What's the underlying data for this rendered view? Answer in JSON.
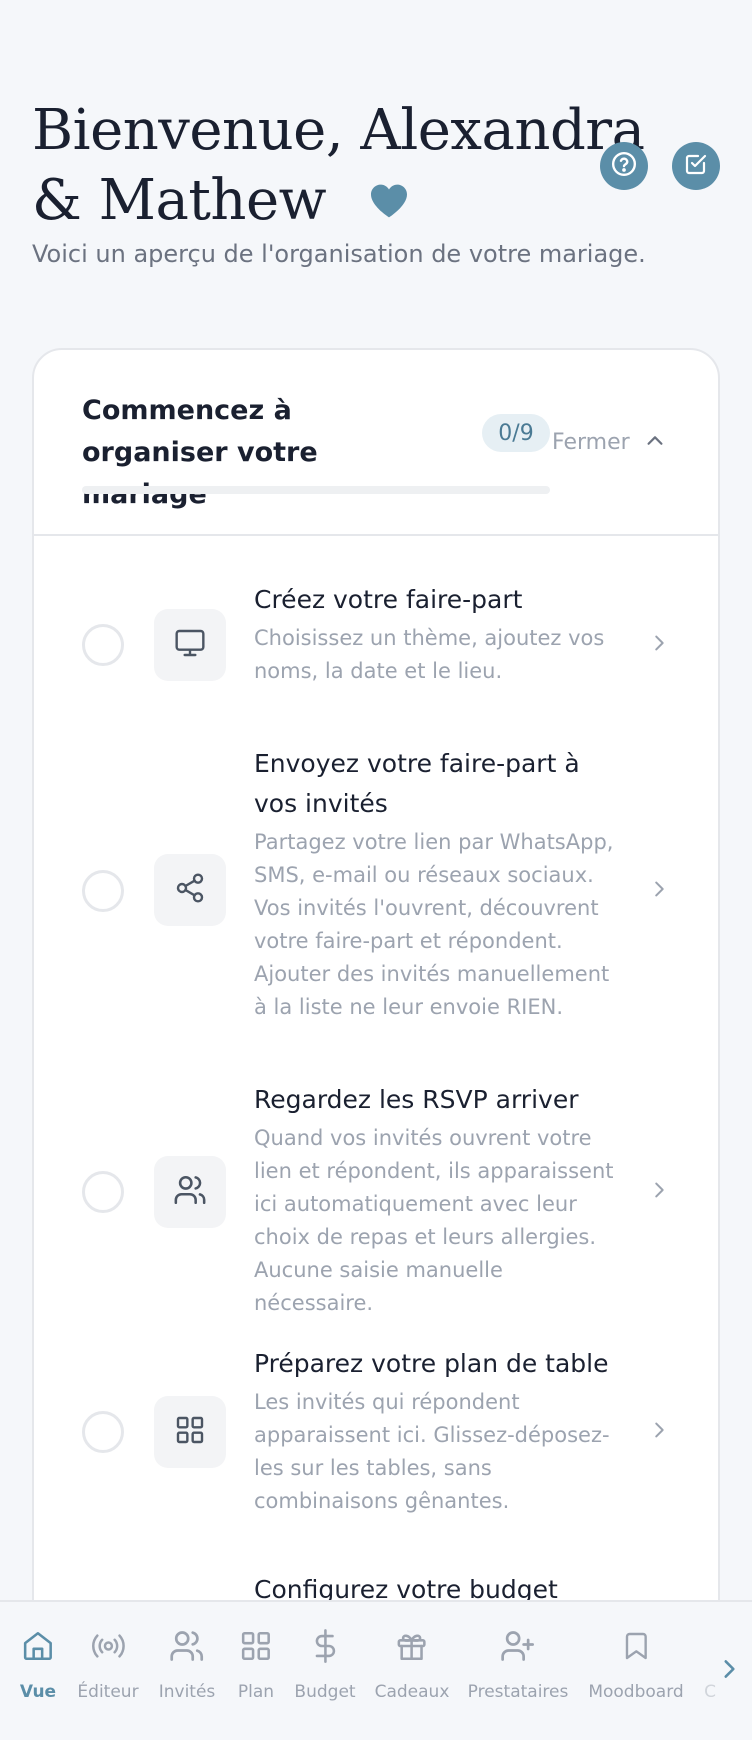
{
  "header": {
    "title_line1": "Bienvenue, Alexandra",
    "title_line2": "& Mathew",
    "subtitle": "Voici un aperçu de l'organisation de votre mariage."
  },
  "checklist": {
    "title": "Commencez à organiser votre mariage",
    "count": "0/9",
    "progress": 0,
    "close_label": "Fermer",
    "tasks": [
      {
        "icon": "monitor-icon",
        "title": "Créez votre faire-part",
        "desc": "Choisissez un thème, ajoutez vos noms, la date et le lieu."
      },
      {
        "icon": "share-icon",
        "title": "Envoyez votre faire-part à vos invités",
        "desc": "Partagez votre lien par WhatsApp, SMS, e-mail ou réseaux sociaux. Vos invités l'ouvrent, découvrent votre faire-part et répondent. Ajouter des invités manuellement à la liste ne leur envoie RIEN."
      },
      {
        "icon": "users-icon",
        "title": "Regardez les RSVP arriver",
        "desc": "Quand vos invités ouvrent votre lien et répondent, ils apparaissent ici automatiquement avec leur choix de repas et leurs allergies. Aucune saisie manuelle nécessaire."
      },
      {
        "icon": "grid-icon",
        "title": "Préparez votre plan de table",
        "desc": "Les invités qui répondent apparaissent ici. Glissez-déposez-les sur les tables, sans combinaisons gênantes."
      },
      {
        "icon": "",
        "title": "Configurez votre budget",
        "desc": ""
      }
    ]
  },
  "nav": {
    "items": [
      {
        "label": "Vue",
        "icon": "home-icon",
        "active": true
      },
      {
        "label": "Éditeur",
        "icon": "broadcast-icon"
      },
      {
        "label": "Invités",
        "icon": "users-icon"
      },
      {
        "label": "Plan",
        "icon": "grid-icon"
      },
      {
        "label": "Budget",
        "icon": "dollar-icon"
      },
      {
        "label": "Cadeaux",
        "icon": "gift-icon"
      },
      {
        "label": "Prestataires",
        "icon": "user-plus-icon"
      },
      {
        "label": "Moodboard",
        "icon": "bookmark-icon"
      },
      {
        "label": "C",
        "icon": ""
      }
    ]
  },
  "colors": {
    "accent": "#5b8ea8",
    "badge_bg": "#e6eff4",
    "muted": "#9ca3af"
  }
}
